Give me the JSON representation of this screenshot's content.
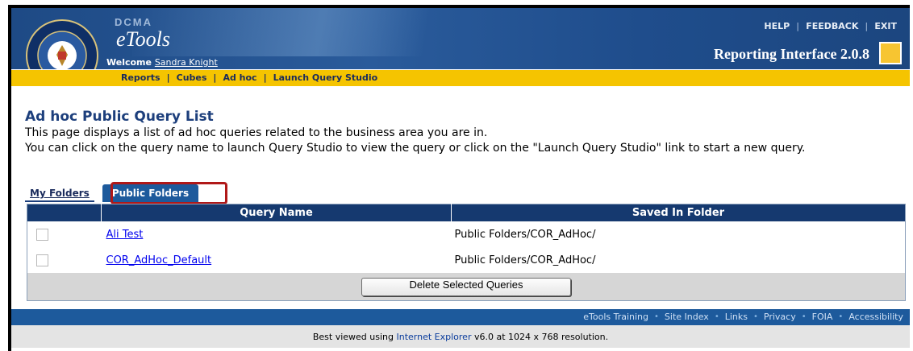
{
  "header": {
    "org_mark": "DCMA",
    "app_name": "eTools",
    "welcome_label": "Welcome",
    "user_name": "Sandra Knight",
    "top_links": [
      "HELP",
      "FEEDBACK",
      "EXIT"
    ],
    "interface_title": "Reporting Interface 2.0.8"
  },
  "nav": {
    "items": [
      "Reports",
      "Cubes",
      "Ad hoc",
      "Launch Query Studio"
    ]
  },
  "main": {
    "title": "Ad hoc Public Query List",
    "description_1": "This page displays a list of ad hoc queries related to the business area you are in.",
    "description_2": "You can click on the query name to launch Query Studio to view the query or click on the \"Launch Query Studio\" link to start a new query.",
    "tabs": [
      {
        "label": "My Folders",
        "active": false
      },
      {
        "label": "Public Folders",
        "active": true
      }
    ],
    "table": {
      "columns": [
        "",
        "Query Name",
        "Saved In Folder"
      ],
      "rows": [
        {
          "name": "Ali Test",
          "folder": "Public Folders/COR_AdHoc/",
          "checked": false
        },
        {
          "name": "COR_AdHoc_Default",
          "folder": "Public Folders/COR_AdHoc/",
          "checked": false
        }
      ],
      "delete_button": "Delete Selected Queries"
    }
  },
  "footer": {
    "links": [
      "eTools Training",
      "Site Index",
      "Links",
      "Privacy",
      "FOIA",
      "Accessibility"
    ],
    "note_prefix": "Best viewed using",
    "note_link": "Internet Explorer",
    "note_suffix": "v6.0 at 1024 x 768 resolution."
  },
  "colors": {
    "header_blue": "#1e4a85",
    "nav_gold": "#f5c400",
    "table_header": "#15396f",
    "highlight_red": "#b01818"
  }
}
